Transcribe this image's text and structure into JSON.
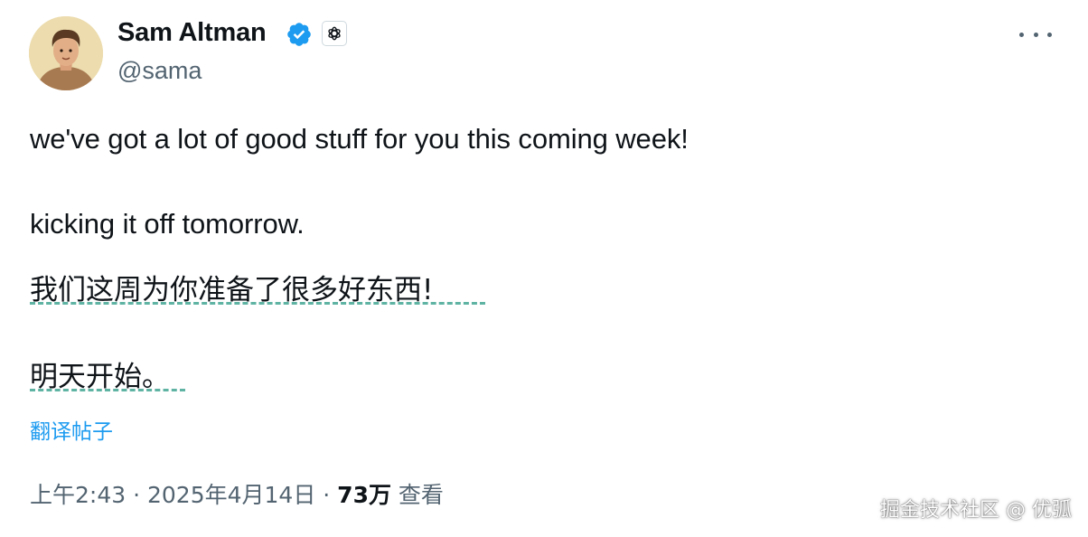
{
  "author": {
    "name": "Sam Altman",
    "handle": "@sama"
  },
  "post": {
    "line1": "we've got a lot of good stuff for you this coming week!",
    "line2": "kicking it off tomorrow.",
    "translation_line1": "我们这周为你准备了很多好东西!",
    "translation_line2": "明天开始。",
    "translate_link": "翻译帖子"
  },
  "meta": {
    "time": "上午2:43",
    "separator1": " · ",
    "date": "2025年4月14日",
    "separator2": " · ",
    "views_count": "73万",
    "views_label": "查看"
  },
  "watermark": "掘金技术社区 @ 优弧",
  "colors": {
    "verified": "#1d9bf0",
    "link": "#1d9bf0",
    "muted": "#536471",
    "underline": "#5fb3a3"
  },
  "icons": {
    "verified": "verified-badge-icon",
    "org": "openai-logo-icon",
    "more": "more-horizontal-icon"
  }
}
